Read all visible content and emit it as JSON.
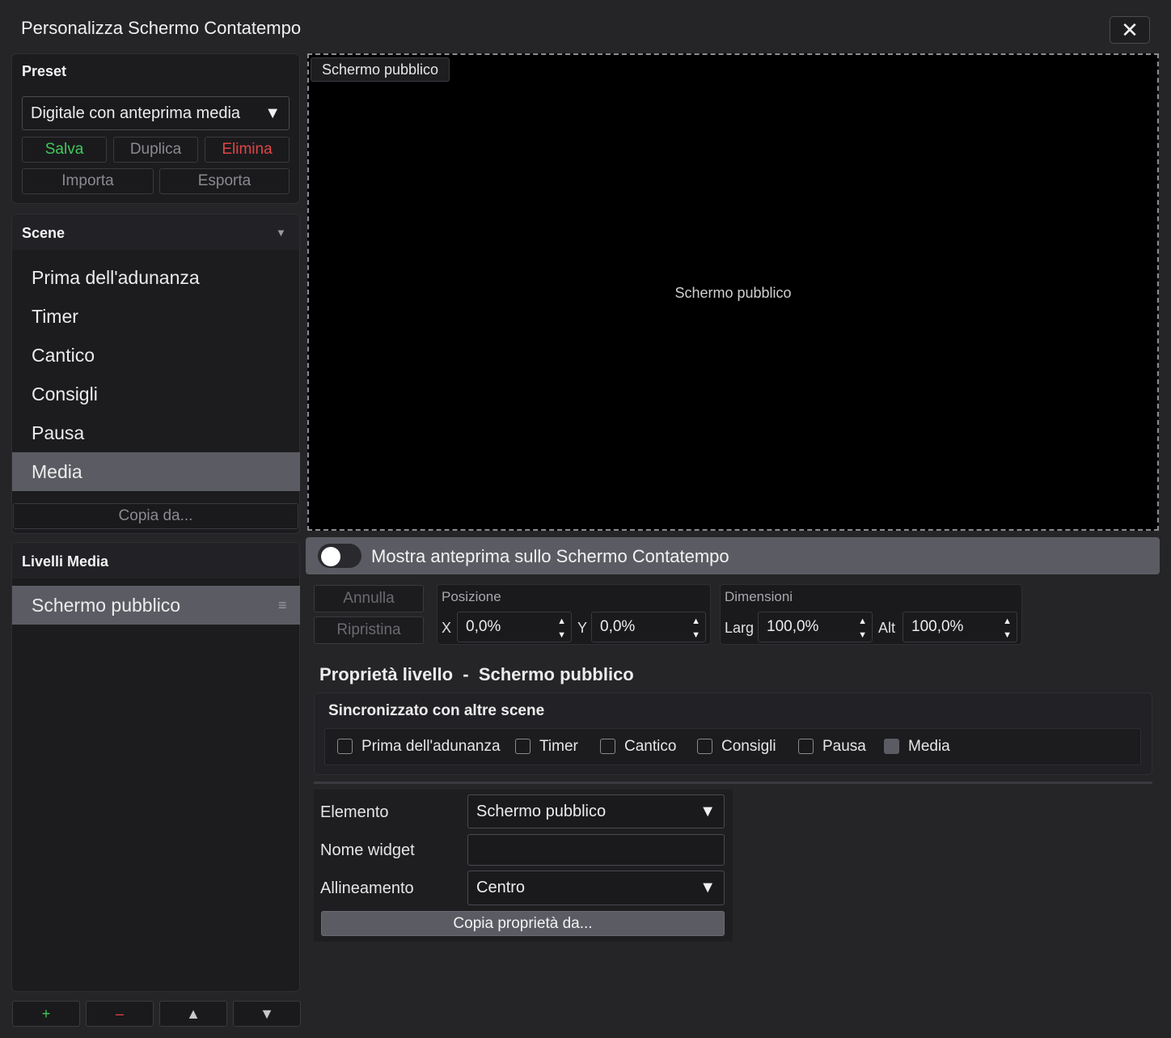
{
  "window": {
    "title": "Personalizza Schermo Contatempo"
  },
  "preset": {
    "header": "Preset",
    "selected": "Digitale con anteprima media",
    "save": "Salva",
    "duplicate": "Duplica",
    "delete": "Elimina",
    "import": "Importa",
    "export": "Esporta"
  },
  "scenes": {
    "header": "Scene",
    "items": [
      "Prima dell'adunanza",
      "Timer",
      "Cantico",
      "Consigli",
      "Pausa",
      "Media"
    ],
    "selected_index": 5,
    "copy_from": "Copia da..."
  },
  "layers": {
    "header": "Livelli Media",
    "items": [
      "Schermo pubblico"
    ]
  },
  "preview": {
    "tab": "Schermo pubblico",
    "center": "Schermo pubblico",
    "toggle_label": "Mostra anteprima sullo Schermo Contatempo",
    "toggle_on": false
  },
  "edit": {
    "undo": "Annulla",
    "restore": "Ripristina",
    "position_label": "Posizione",
    "x_label": "X",
    "x_value": "0,0%",
    "y_label": "Y",
    "y_value": "0,0%",
    "size_label": "Dimensioni",
    "w_label": "Larg",
    "w_value": "100,0%",
    "h_label": "Alt",
    "h_value": "100,0%"
  },
  "props": {
    "title": "Proprietà livello  -  Schermo pubblico",
    "sync_title": "Sincronizzato con altre scene",
    "sync": [
      {
        "label": "Prima dell'adunanza",
        "checked": false
      },
      {
        "label": "Timer",
        "checked": false
      },
      {
        "label": "Cantico",
        "checked": false
      },
      {
        "label": "Consigli",
        "checked": false
      },
      {
        "label": "Pausa",
        "checked": false
      },
      {
        "label": "Media",
        "checked": true
      }
    ],
    "element_label": "Elemento",
    "element_value": "Schermo pubblico",
    "widget_label": "Nome widget",
    "widget_value": "",
    "align_label": "Allineamento",
    "align_value": "Centro",
    "copy_props": "Copia proprietà da..."
  },
  "bottom": {
    "add": "+",
    "remove": "–",
    "up": "▲",
    "down": "▼"
  },
  "colors": {
    "selected_bg": "#5b5c63",
    "save": "#3fca5a",
    "delete": "#e04545"
  }
}
